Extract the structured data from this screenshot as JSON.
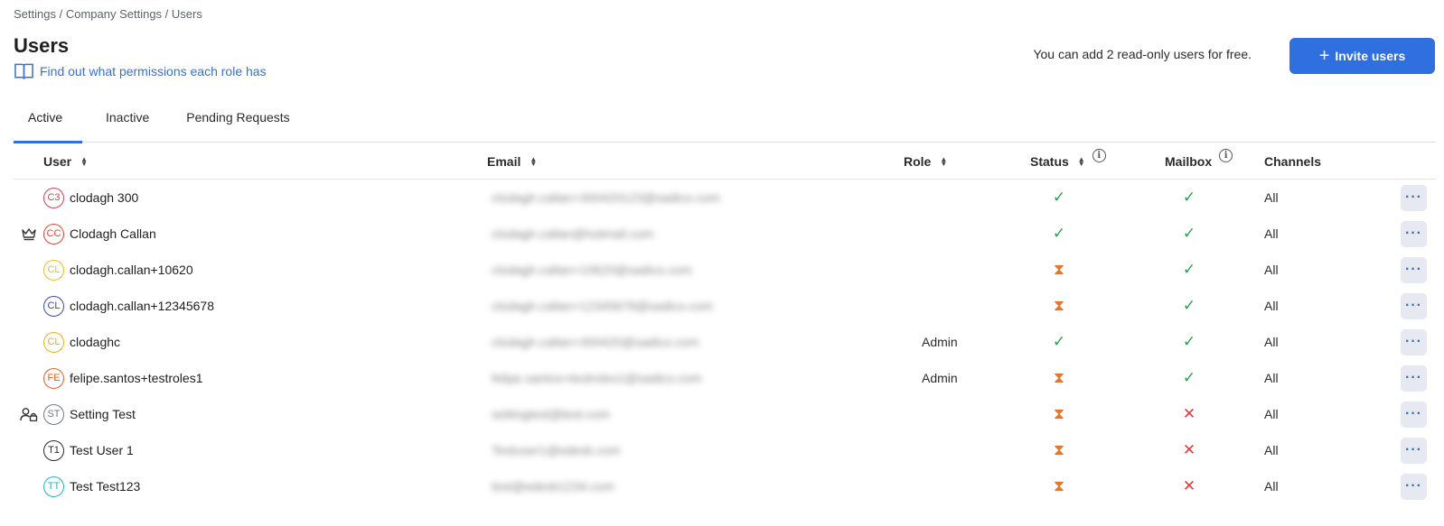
{
  "breadcrumb": [
    "Settings",
    "Company Settings",
    "Users"
  ],
  "breadcrumb_separator": " / ",
  "page_title": "Users",
  "permissions_link": "Find out what permissions each role has",
  "free_note": "You can add 2 read-only users for free.",
  "invite_button": "Invite users",
  "tabs": [
    {
      "label": "Active",
      "active": true
    },
    {
      "label": "Inactive",
      "active": false
    },
    {
      "label": "Pending Requests",
      "active": false
    }
  ],
  "columns": {
    "user": "User",
    "email": "Email",
    "role": "Role",
    "status": "Status",
    "mailbox": "Mailbox",
    "channels": "Channels"
  },
  "status_icons": {
    "ok": "✓",
    "pending": "⧗",
    "no": "✕"
  },
  "more_label": "···",
  "users": [
    {
      "badge": "",
      "initials": "C3",
      "avatar_color": "#d4405c",
      "name": "clodagh 300",
      "email": "clodagh.callan+300420123@sadico.com",
      "role": "",
      "status": "ok",
      "mailbox": "ok",
      "channels": "All"
    },
    {
      "badge": "crown-icon",
      "initials": "CC",
      "avatar_color": "#e0483a",
      "name": "Clodagh Callan",
      "email": "clodagh.callan@hotmail.com",
      "role": "",
      "status": "ok",
      "mailbox": "ok",
      "channels": "All"
    },
    {
      "badge": "",
      "initials": "CL",
      "avatar_color": "#e8c12a",
      "name": "clodagh.callan+10620",
      "email": "clodagh.callan+10620@sadico.com",
      "role": "",
      "status": "pending",
      "mailbox": "ok",
      "channels": "All"
    },
    {
      "badge": "",
      "initials": "CL",
      "avatar_color": "#3b4aa8",
      "name": "clodagh.callan+12345678",
      "email": "clodagh.callan+12345678@sadico.com",
      "role": "",
      "status": "pending",
      "mailbox": "ok",
      "channels": "All"
    },
    {
      "badge": "",
      "initials": "CL",
      "avatar_color": "#e8b31a",
      "name": "clodaghc",
      "email": "clodagh.callan+300420@sadico.com",
      "role": "Admin",
      "status": "ok",
      "mailbox": "ok",
      "channels": "All"
    },
    {
      "badge": "",
      "initials": "FE",
      "avatar_color": "#e0602a",
      "name": "felipe.santos+testroles1",
      "email": "felipe.santos+testroles1@sadico.com",
      "role": "Admin",
      "status": "pending",
      "mailbox": "ok",
      "channels": "All"
    },
    {
      "badge": "user-lock-icon",
      "initials": "ST",
      "avatar_color": "#6b7a8c",
      "name": "Setting Test",
      "email": "settingtest@test.com",
      "role": "",
      "status": "pending",
      "mailbox": "no",
      "channels": "All"
    },
    {
      "badge": "",
      "initials": "T1",
      "avatar_color": "#2b2b2b",
      "name": "Test User 1",
      "email": "Testuser1@edesk.com",
      "role": "",
      "status": "pending",
      "mailbox": "no",
      "channels": "All"
    },
    {
      "badge": "",
      "initials": "TT",
      "avatar_color": "#27b3c9",
      "name": "Test Test123",
      "email": "test@edesk1234.com",
      "role": "",
      "status": "pending",
      "mailbox": "no",
      "channels": "All"
    }
  ]
}
